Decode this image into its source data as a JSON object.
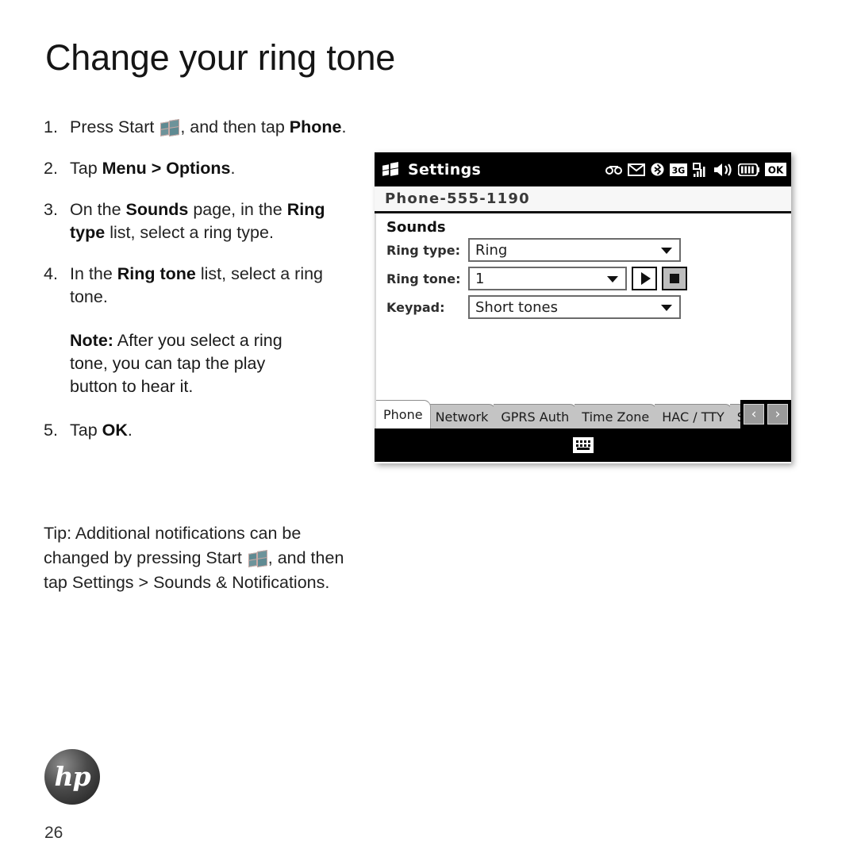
{
  "page": {
    "title": "Change your ring tone",
    "number": "26",
    "logo_text": "hp"
  },
  "steps": [
    {
      "num": "1.",
      "parts": [
        {
          "t": "Press Start ",
          "b": false
        },
        {
          "t": "START_ICON",
          "b": false,
          "icon": true
        },
        {
          "t": ", and then tap ",
          "b": false
        },
        {
          "t": "Phone",
          "b": true
        },
        {
          "t": ".",
          "b": false
        }
      ]
    },
    {
      "num": "2.",
      "parts": [
        {
          "t": "Tap ",
          "b": false
        },
        {
          "t": "Menu > Options",
          "b": true
        },
        {
          "t": ".",
          "b": false
        }
      ]
    },
    {
      "num": "3.",
      "parts": [
        {
          "t": "On the ",
          "b": false
        },
        {
          "t": "Sounds",
          "b": true
        },
        {
          "t": " page, in the ",
          "b": false
        },
        {
          "t": "Ring type",
          "b": true
        },
        {
          "t": " list, select a ring type.",
          "b": false
        }
      ]
    },
    {
      "num": "4.",
      "parts": [
        {
          "t": "In the ",
          "b": false
        },
        {
          "t": "Ring tone",
          "b": true
        },
        {
          "t": " list, select a ring tone.",
          "b": false
        }
      ]
    }
  ],
  "note": {
    "parts": [
      {
        "t": "Note:",
        "b": true
      },
      {
        "t": "  After you select a ring tone, you can tap the play button to hear it.",
        "b": false
      }
    ]
  },
  "step5": {
    "num": "5.",
    "parts": [
      {
        "t": "Tap ",
        "b": false
      },
      {
        "t": "OK",
        "b": true
      },
      {
        "t": ".",
        "b": false
      }
    ]
  },
  "tip": {
    "parts": [
      {
        "t": "Tip:",
        "b": true
      },
      {
        "t": "  Additional notifications can be changed by pressing Start ",
        "b": false
      },
      {
        "t": "START_ICON",
        "b": false,
        "icon": true
      },
      {
        "t": ", and then tap ",
        "b": false
      },
      {
        "t": "Settings > Sounds & Notifications",
        "b": true
      },
      {
        "t": ".",
        "b": false
      }
    ]
  },
  "device": {
    "titlebar": {
      "start_icon": "windows-flag-icon",
      "title": "Settings",
      "status_icons": [
        {
          "name": "voicemail-icon",
          "label": "voicemail"
        },
        {
          "name": "message-icon",
          "label": "envelope"
        },
        {
          "name": "bluetooth-icon",
          "label": "bluetooth"
        },
        {
          "name": "network-3g-icon",
          "label": "3G"
        },
        {
          "name": "signal-strength-icon",
          "label": "signal"
        },
        {
          "name": "speaker-icon",
          "label": "speaker"
        },
        {
          "name": "battery-icon",
          "label": "battery"
        },
        {
          "name": "ok-button-icon",
          "label": "OK"
        }
      ]
    },
    "phone_number": "Phone-555-1190",
    "section_header": "Sounds",
    "fields": [
      {
        "label": "Ring type:",
        "value": "Ring"
      },
      {
        "label": "Ring tone:",
        "value": "1"
      },
      {
        "label": "Keypad:",
        "value": "Short tones"
      }
    ],
    "buttons": {
      "play": "play-button",
      "stop": "stop-button"
    },
    "tabs": [
      {
        "label": "Phone",
        "active": true
      },
      {
        "label": "Network",
        "active": false
      },
      {
        "label": "GPRS Auth",
        "active": false
      },
      {
        "label": "Time Zone",
        "active": false
      },
      {
        "label": "HAC / TTY",
        "active": false
      },
      {
        "label": "S",
        "active": false,
        "clipped": true
      }
    ],
    "tab_nav": {
      "prev": "‹",
      "next": "›"
    },
    "sip_icon": "keyboard-icon"
  },
  "colors": {
    "titlebar_bg": "#000000",
    "tab_inactive": "#c4c4c4",
    "tab_active": "#ffffff",
    "start_flag": "#5f8a92",
    "stop_button_bg": "#bdbdbd"
  }
}
